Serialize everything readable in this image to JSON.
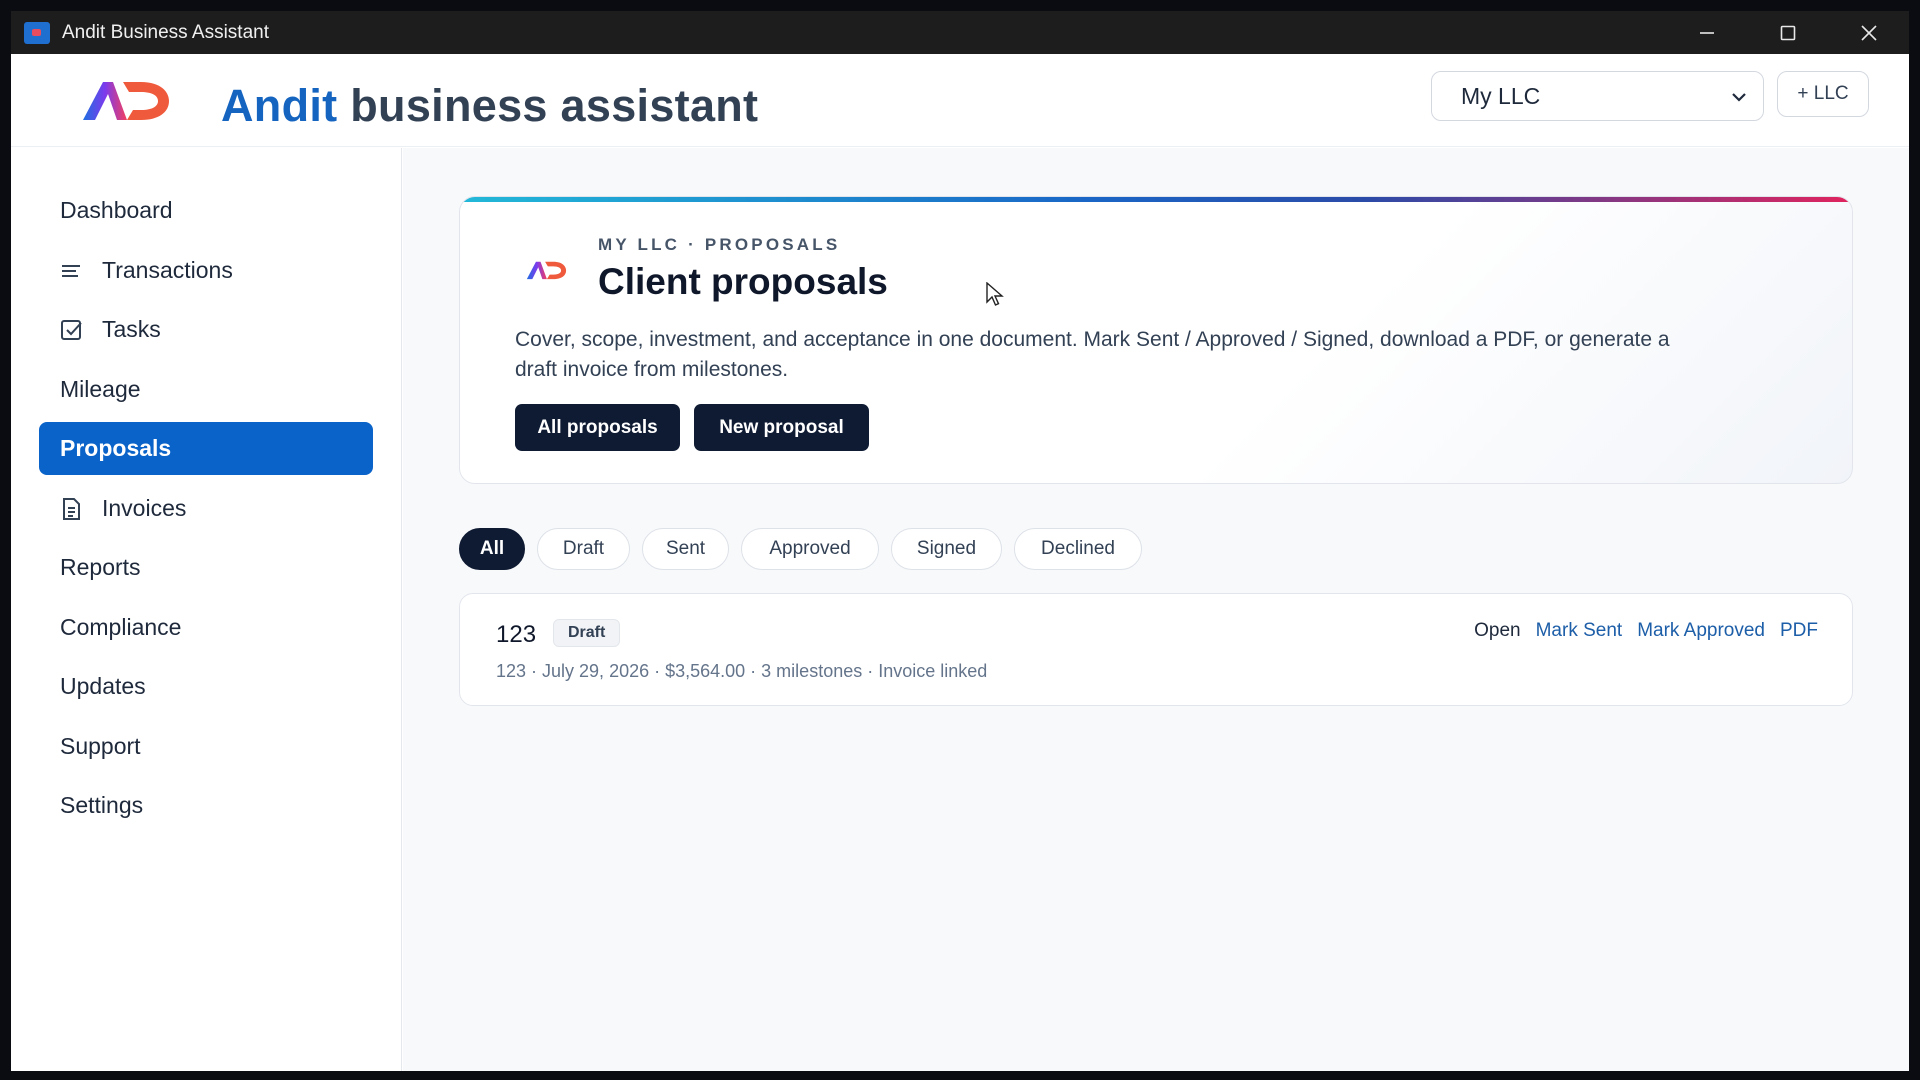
{
  "window": {
    "title": "Andit Business Assistant"
  },
  "header": {
    "brand_first": "Andit",
    "brand_rest": " business assistant",
    "llc_selected": "My LLC",
    "add_llc_label": "+ LLC"
  },
  "sidebar": {
    "items": [
      {
        "label": "Dashboard",
        "icon": ""
      },
      {
        "label": "Transactions",
        "icon": "list-icon"
      },
      {
        "label": "Tasks",
        "icon": "checkbox-icon"
      },
      {
        "label": "Mileage",
        "icon": ""
      },
      {
        "label": "Proposals",
        "icon": "",
        "active": true
      },
      {
        "label": "Invoices",
        "icon": "document-icon"
      },
      {
        "label": "Reports",
        "icon": ""
      },
      {
        "label": "Compliance",
        "icon": ""
      },
      {
        "label": "Updates",
        "icon": ""
      },
      {
        "label": "Support",
        "icon": ""
      },
      {
        "label": "Settings",
        "icon": ""
      }
    ]
  },
  "hero": {
    "eyebrow": "MY LLC · PROPOSALS",
    "title": "Client proposals",
    "description": "Cover, scope, investment, and acceptance in one document. Mark Sent / Approved / Signed, download a PDF, or generate a draft invoice from milestones.",
    "all_button": "All proposals",
    "new_button": "New proposal"
  },
  "filters": {
    "selected": "All",
    "chips": [
      "All",
      "Draft",
      "Sent",
      "Approved",
      "Signed",
      "Declined"
    ]
  },
  "proposals": [
    {
      "name": "123",
      "status": "Draft",
      "meta": "123 · July 29, 2026 · $3,564.00 · 3 milestones · Invoice linked",
      "actions": [
        "Open",
        "Mark Sent",
        "Mark Approved",
        "PDF"
      ]
    }
  ],
  "colors": {
    "accent": "#0a63c9",
    "dark_button": "#0f1b33",
    "link": "#1d5ea8"
  }
}
